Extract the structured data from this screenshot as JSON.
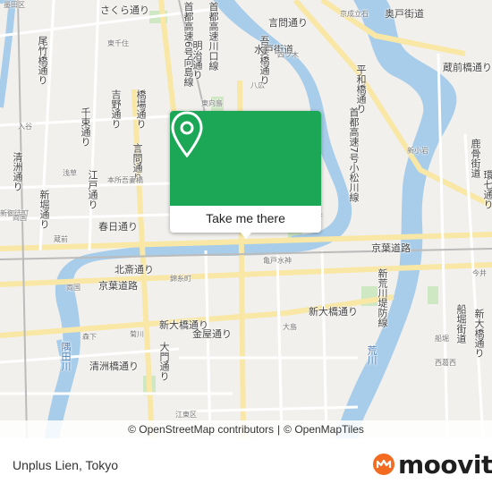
{
  "card": {
    "label": "Take me there",
    "pin_icon": "map-pin-icon",
    "color": "#1ba756"
  },
  "attribution": {
    "osm": "© OpenStreetMap contributors",
    "sep": "|",
    "omt": "© OpenMapTiles"
  },
  "footer": {
    "title": "Unplus Lien, Tokyo"
  },
  "logo": {
    "text": "moovit",
    "icon": "moovit-logo-icon",
    "color": "#f26b21"
  },
  "map_labels": [
    {
      "text": "さくら通り",
      "cls": "road"
    },
    {
      "text": "首都高速6号向島線",
      "cls": "road vert"
    },
    {
      "text": "首都高速川口線",
      "cls": "road vert"
    },
    {
      "text": "墨田区",
      "cls": "small"
    },
    {
      "text": "京成立石",
      "cls": "small"
    },
    {
      "text": "奥戸街道",
      "cls": "road"
    },
    {
      "text": "尾竹橋通り",
      "cls": "road vert"
    },
    {
      "text": "言問通り",
      "cls": "road"
    },
    {
      "text": "東千住",
      "cls": "small"
    },
    {
      "text": "吾妻橋通り",
      "cls": "road vert"
    },
    {
      "text": "水戸街道",
      "cls": "road"
    },
    {
      "text": "明治通り",
      "cls": "road vert"
    },
    {
      "text": "四ツ木",
      "cls": "small"
    },
    {
      "text": "平和橋通り",
      "cls": "road vert"
    },
    {
      "text": "蔵前橋通り",
      "cls": "road"
    },
    {
      "text": "入谷",
      "cls": "small"
    },
    {
      "text": "吉野通り",
      "cls": "road vert"
    },
    {
      "text": "橋場通り",
      "cls": "road vert"
    },
    {
      "text": "八広",
      "cls": "small"
    },
    {
      "text": "東向島",
      "cls": "small"
    },
    {
      "text": "首都高速7号小松川線",
      "cls": "road vert"
    },
    {
      "text": "清洲通り",
      "cls": "road vert"
    },
    {
      "text": "千束通り",
      "cls": "road vert"
    },
    {
      "text": "浅草",
      "cls": "small"
    },
    {
      "text": "江戸通り",
      "cls": "road vert"
    },
    {
      "text": "言問通り",
      "cls": "road vert"
    },
    {
      "text": "新小岩",
      "cls": "small"
    },
    {
      "text": "新堀通り",
      "cls": "road vert"
    },
    {
      "text": "本所吾妻橋",
      "cls": "small"
    },
    {
      "text": "春日通り",
      "cls": "road"
    },
    {
      "text": "新御徒町",
      "cls": "small"
    },
    {
      "text": "蔵前",
      "cls": "small"
    },
    {
      "text": "平井",
      "cls": "small"
    },
    {
      "text": "京葉道路",
      "cls": "road"
    },
    {
      "text": "北斎通り",
      "cls": "road"
    },
    {
      "text": "亀戸水神",
      "cls": "small"
    },
    {
      "text": "両国",
      "cls": "small"
    },
    {
      "text": "錦糸町",
      "cls": "small"
    },
    {
      "text": "京葉道路",
      "cls": "road"
    },
    {
      "text": "新荒川堤防線",
      "cls": "road vert"
    },
    {
      "text": "船堀街道",
      "cls": "road vert"
    },
    {
      "text": "新大橋通り",
      "cls": "road"
    },
    {
      "text": "新大橋通り",
      "cls": "road"
    },
    {
      "text": "菊川",
      "cls": "small"
    },
    {
      "text": "森下",
      "cls": "small"
    },
    {
      "text": "金屋通り",
      "cls": "road"
    },
    {
      "text": "大島",
      "cls": "small"
    },
    {
      "text": "船堀",
      "cls": "small"
    },
    {
      "text": "新大橋通り",
      "cls": "road vert"
    },
    {
      "text": "清洲橋通り",
      "cls": "road"
    },
    {
      "text": "大門通り",
      "cls": "road vert"
    },
    {
      "text": "隅田川",
      "cls": "river vert"
    },
    {
      "text": "荒川",
      "cls": "river vert"
    },
    {
      "text": "江東区",
      "cls": "small"
    },
    {
      "text": "今井",
      "cls": "small"
    },
    {
      "text": "西葛西",
      "cls": "small"
    },
    {
      "text": "鹿骨街道",
      "cls": "road vert"
    },
    {
      "text": "環七通り",
      "cls": "road vert"
    },
    {
      "text": "両国",
      "cls": "small"
    }
  ]
}
